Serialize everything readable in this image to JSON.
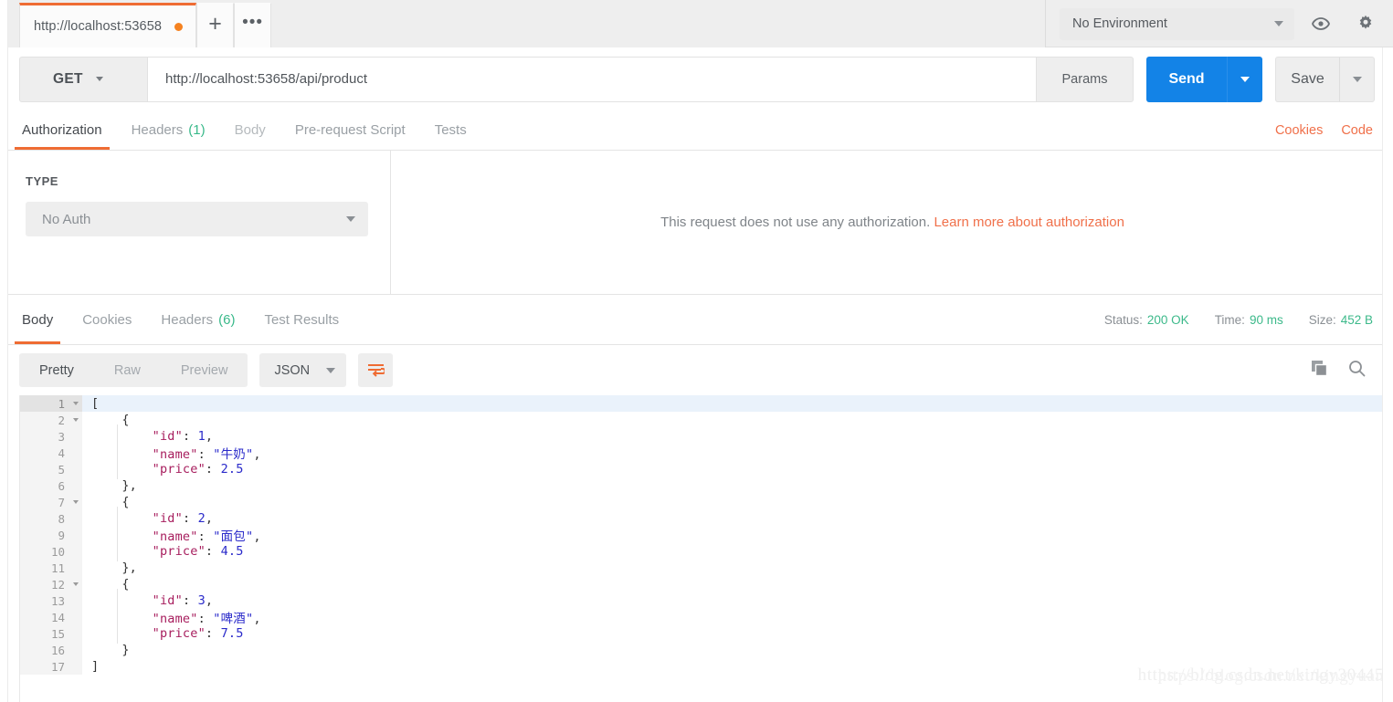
{
  "topbar": {
    "request_tab": {
      "label": "http://localhost:53658",
      "unsaved": "●"
    },
    "new_tab_label": "+",
    "more_tabs_label": "•••",
    "environment": {
      "value": "No Environment"
    },
    "eye_icon": "eye-icon",
    "settings_icon": "gear-icon"
  },
  "request": {
    "method": "GET",
    "url": "http://localhost:53658/api/product",
    "params_label": "Params",
    "send_label": "Send",
    "save_label": "Save"
  },
  "request_tabs": {
    "items": [
      {
        "label": "Authorization",
        "count": "",
        "state": "active"
      },
      {
        "label": "Headers",
        "count": "(1)",
        "state": "normal"
      },
      {
        "label": "Body",
        "count": "",
        "state": "dim"
      },
      {
        "label": "Pre-request Script",
        "count": "",
        "state": "normal"
      },
      {
        "label": "Tests",
        "count": "",
        "state": "normal"
      }
    ],
    "cookies_label": "Cookies",
    "code_label": "Code"
  },
  "auth": {
    "type_label": "TYPE",
    "type_value": "No Auth",
    "message": "This request does not use any authorization.",
    "link": "Learn more about authorization"
  },
  "response_tabs": {
    "items": [
      {
        "label": "Body",
        "count": "",
        "state": "active"
      },
      {
        "label": "Cookies",
        "count": "",
        "state": "normal"
      },
      {
        "label": "Headers",
        "count": "(6)",
        "state": "normal"
      },
      {
        "label": "Test Results",
        "count": "",
        "state": "normal"
      }
    ],
    "status_label": "Status:",
    "status_value": "200 OK",
    "time_label": "Time:",
    "time_value": "90 ms",
    "size_label": "Size:",
    "size_value": "452 B"
  },
  "format_bar": {
    "modes": [
      {
        "label": "Pretty",
        "state": "active"
      },
      {
        "label": "Raw",
        "state": "normal"
      },
      {
        "label": "Preview",
        "state": "normal"
      }
    ],
    "language": "JSON",
    "wrap_icon": "word-wrap-icon",
    "copy_icon": "copy-icon",
    "search_icon": "search-icon"
  },
  "response_body": {
    "lines": [
      {
        "n": "1",
        "fold": true,
        "indent": 0,
        "tokens": [
          {
            "t": "[",
            "c": "punc"
          }
        ]
      },
      {
        "n": "2",
        "fold": true,
        "indent": 1,
        "tokens": [
          {
            "t": "{",
            "c": "punc"
          }
        ]
      },
      {
        "n": "3",
        "fold": false,
        "indent": 2,
        "tokens": [
          {
            "t": "\"id\"",
            "c": "key"
          },
          {
            "t": ": ",
            "c": "punc"
          },
          {
            "t": "1",
            "c": "num"
          },
          {
            "t": ",",
            "c": "punc"
          }
        ]
      },
      {
        "n": "4",
        "fold": false,
        "indent": 2,
        "tokens": [
          {
            "t": "\"name\"",
            "c": "key"
          },
          {
            "t": ": ",
            "c": "punc"
          },
          {
            "t": "\"牛奶\"",
            "c": "str"
          },
          {
            "t": ",",
            "c": "punc"
          }
        ]
      },
      {
        "n": "5",
        "fold": false,
        "indent": 2,
        "tokens": [
          {
            "t": "\"price\"",
            "c": "key"
          },
          {
            "t": ": ",
            "c": "punc"
          },
          {
            "t": "2.5",
            "c": "num"
          }
        ]
      },
      {
        "n": "6",
        "fold": false,
        "indent": 1,
        "tokens": [
          {
            "t": "},",
            "c": "punc"
          }
        ]
      },
      {
        "n": "7",
        "fold": true,
        "indent": 1,
        "tokens": [
          {
            "t": "{",
            "c": "punc"
          }
        ]
      },
      {
        "n": "8",
        "fold": false,
        "indent": 2,
        "tokens": [
          {
            "t": "\"id\"",
            "c": "key"
          },
          {
            "t": ": ",
            "c": "punc"
          },
          {
            "t": "2",
            "c": "num"
          },
          {
            "t": ",",
            "c": "punc"
          }
        ]
      },
      {
        "n": "9",
        "fold": false,
        "indent": 2,
        "tokens": [
          {
            "t": "\"name\"",
            "c": "key"
          },
          {
            "t": ": ",
            "c": "punc"
          },
          {
            "t": "\"面包\"",
            "c": "str"
          },
          {
            "t": ",",
            "c": "punc"
          }
        ]
      },
      {
        "n": "10",
        "fold": false,
        "indent": 2,
        "tokens": [
          {
            "t": "\"price\"",
            "c": "key"
          },
          {
            "t": ": ",
            "c": "punc"
          },
          {
            "t": "4.5",
            "c": "num"
          }
        ]
      },
      {
        "n": "11",
        "fold": false,
        "indent": 1,
        "tokens": [
          {
            "t": "},",
            "c": "punc"
          }
        ]
      },
      {
        "n": "12",
        "fold": true,
        "indent": 1,
        "tokens": [
          {
            "t": "{",
            "c": "punc"
          }
        ]
      },
      {
        "n": "13",
        "fold": false,
        "indent": 2,
        "tokens": [
          {
            "t": "\"id\"",
            "c": "key"
          },
          {
            "t": ": ",
            "c": "punc"
          },
          {
            "t": "3",
            "c": "num"
          },
          {
            "t": ",",
            "c": "punc"
          }
        ]
      },
      {
        "n": "14",
        "fold": false,
        "indent": 2,
        "tokens": [
          {
            "t": "\"name\"",
            "c": "key"
          },
          {
            "t": ": ",
            "c": "punc"
          },
          {
            "t": "\"啤酒\"",
            "c": "str"
          },
          {
            "t": ",",
            "c": "punc"
          }
        ]
      },
      {
        "n": "15",
        "fold": false,
        "indent": 2,
        "tokens": [
          {
            "t": "\"price\"",
            "c": "key"
          },
          {
            "t": ": ",
            "c": "punc"
          },
          {
            "t": "7.5",
            "c": "num"
          }
        ]
      },
      {
        "n": "16",
        "fold": false,
        "indent": 1,
        "tokens": [
          {
            "t": "}",
            "c": "punc"
          }
        ]
      },
      {
        "n": "17",
        "fold": false,
        "indent": 0,
        "tokens": [
          {
            "t": "]",
            "c": "punc"
          }
        ]
      }
    ]
  },
  "watermark": {
    "text_a": "https://blog.csdn.net/kingyuan",
    "text_b": "https://blog.csdn.net/kingy30445"
  },
  "colors": {
    "accent_orange": "#ef6c33",
    "send_blue": "#1383e7",
    "status_green": "#3cb98a",
    "json_key": "#a71d5d",
    "json_value": "#2a2aca"
  }
}
